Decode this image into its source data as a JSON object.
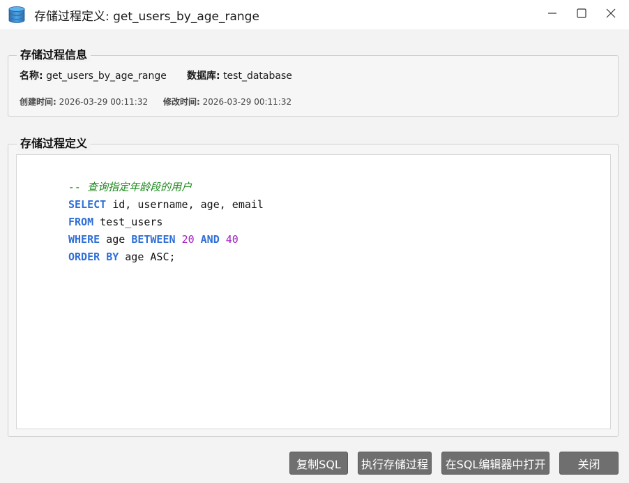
{
  "window": {
    "title": "存储过程定义: get_users_by_age_range",
    "icon": "database-icon"
  },
  "info_group": {
    "title": "存储过程信息",
    "name_label": "名称:",
    "name_value": "get_users_by_age_range",
    "database_label": "数据库:",
    "database_value": "test_database",
    "created_label": "创建时间:",
    "created_value": "2026-03-29 00:11:32",
    "modified_label": "修改时间:",
    "modified_value": "2026-03-29 00:11:32"
  },
  "definition_group": {
    "title": "存储过程定义",
    "code_lines": [
      [
        {
          "t": "-- 查询指定年龄段的用户",
          "c": "cmt"
        }
      ],
      [
        {
          "t": "SELECT",
          "c": "kw"
        },
        {
          "t": " id, username, age, email",
          "c": ""
        }
      ],
      [
        {
          "t": "FROM",
          "c": "kw"
        },
        {
          "t": " test_users",
          "c": ""
        }
      ],
      [
        {
          "t": "WHERE",
          "c": "kw"
        },
        {
          "t": " age ",
          "c": ""
        },
        {
          "t": "BETWEEN",
          "c": "kw"
        },
        {
          "t": " ",
          "c": ""
        },
        {
          "t": "20",
          "c": "num"
        },
        {
          "t": " ",
          "c": ""
        },
        {
          "t": "AND",
          "c": "kw"
        },
        {
          "t": " ",
          "c": ""
        },
        {
          "t": "40",
          "c": "num"
        }
      ],
      [
        {
          "t": "ORDER",
          "c": "kw"
        },
        {
          "t": " ",
          "c": ""
        },
        {
          "t": "BY",
          "c": "kw"
        },
        {
          "t": " age ASC;",
          "c": ""
        }
      ]
    ]
  },
  "buttons": {
    "copy": "复制SQL",
    "execute": "执行存储过程",
    "open_editor": "在SQL编辑器中打开",
    "close": "关闭"
  },
  "colors": {
    "keyword": "#2f6fd6",
    "number": "#a020c0",
    "comment": "#1e8a1e",
    "button_bg": "#6f6f6f"
  }
}
